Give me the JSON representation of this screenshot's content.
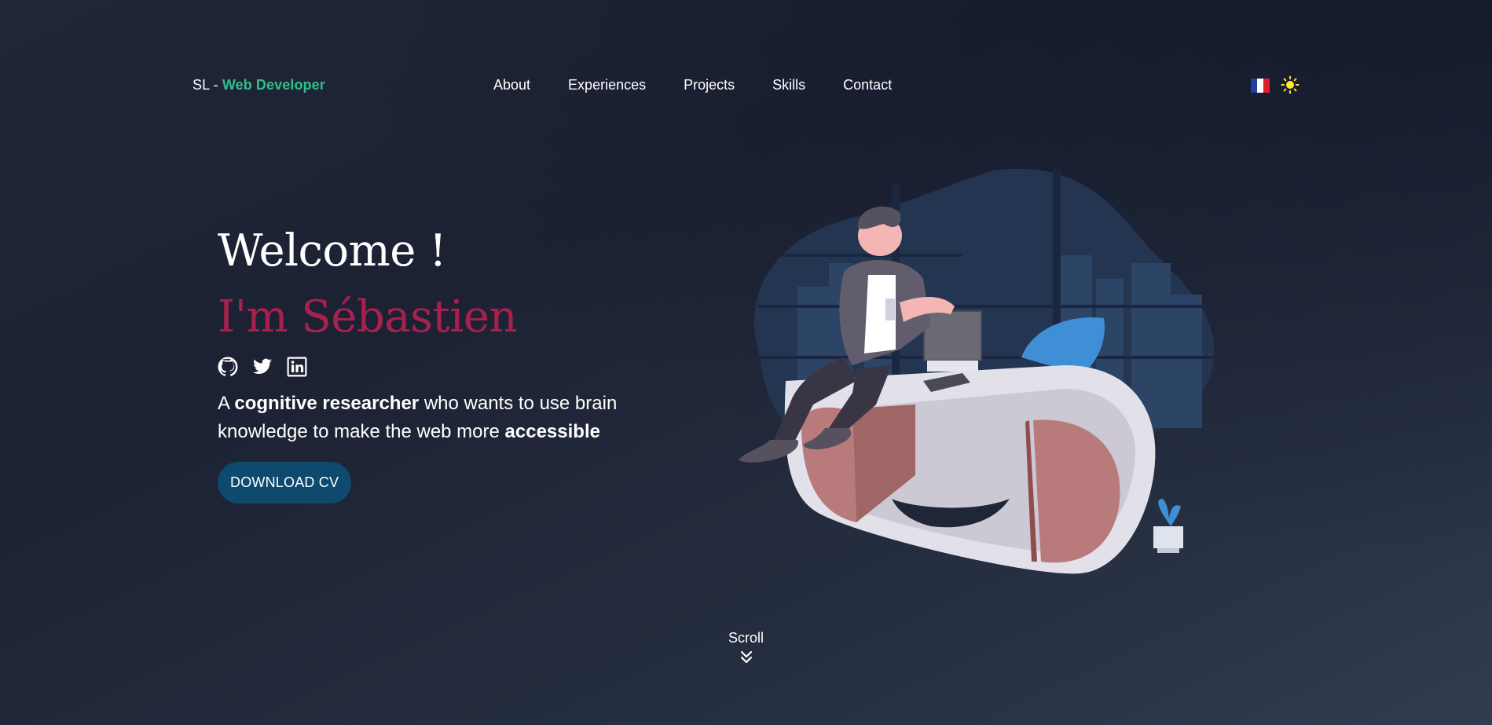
{
  "header": {
    "logo_prefix": "SL - ",
    "logo_accent": "Web Developer",
    "nav": [
      "About",
      "Experiences",
      "Projects",
      "Skills",
      "Contact"
    ],
    "language_icon": "french-flag-icon",
    "theme_icon": "sun-icon"
  },
  "hero": {
    "welcome": "Welcome !",
    "name": "I'm Sébastien",
    "socials": [
      "github-icon",
      "twitter-icon",
      "linkedin-icon"
    ],
    "tagline": {
      "part1": "A ",
      "bold1": "cognitive researcher",
      "part2": " who wants to use brain knowledge to make the web more ",
      "bold2": "accessible"
    },
    "cv_button": "DOWNLOAD CV"
  },
  "scroll": {
    "label": "Scroll",
    "icon": "double-chevron-down-icon"
  },
  "colors": {
    "accent_green": "#2fc08a",
    "name_red": "#a8214d",
    "button_blue": "#0e4a6e",
    "sun_yellow": "#ffe92b"
  }
}
